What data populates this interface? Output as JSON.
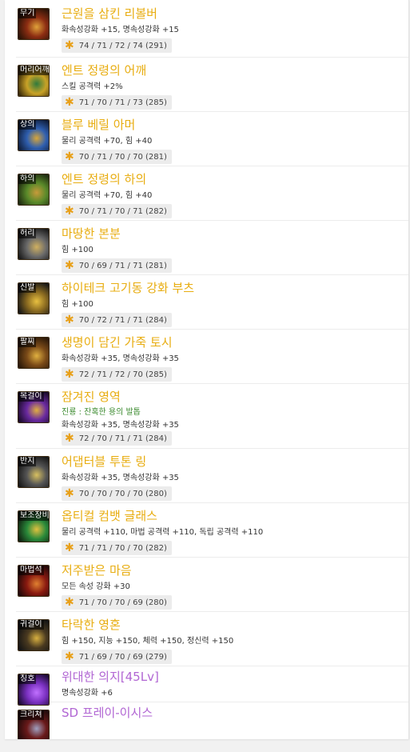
{
  "colors": {
    "legendary": "#e8ad11",
    "epic": "#b166d3",
    "mythic_option": "#3b8a2e",
    "score_star": "#e8a019"
  },
  "items": [
    {
      "slot": "무기",
      "name": "근원을 삼킨 리볼버",
      "stats": [
        "화속성강화 +15, 명속성강화 +15"
      ],
      "score": "74 / 71 / 72 / 74 (291)",
      "rarity": "legendary",
      "icon": "revolver-icon"
    },
    {
      "slot": "머리어깨",
      "name": "엔트 정령의 어깨",
      "stats": [
        "스킬 공격력 +2%"
      ],
      "score": "71 / 70 / 71 / 73 (285)",
      "rarity": "legendary",
      "icon": "shoulder-armor-icon"
    },
    {
      "slot": "상의",
      "name": "블루 베릴 아머",
      "stats": [
        "물리 공격력 +70, 힘 +40"
      ],
      "score": "70 / 71 / 70 / 70 (281)",
      "rarity": "legendary",
      "icon": "armor-icon"
    },
    {
      "slot": "하의",
      "name": "엔트 정령의 하의",
      "stats": [
        "물리 공격력 +70, 힘 +40"
      ],
      "score": "70 / 71 / 70 / 71 (282)",
      "rarity": "legendary",
      "icon": "pants-icon"
    },
    {
      "slot": "허리",
      "name": "마땅한 본분",
      "stats": [
        "힘 +100"
      ],
      "score": "70 / 69 / 71 / 71 (281)",
      "rarity": "legendary",
      "icon": "belt-icon"
    },
    {
      "slot": "신발",
      "name": "하이테크 고기동 강화 부츠",
      "stats": [
        "힘 +100"
      ],
      "score": "70 / 72 / 71 / 71 (284)",
      "rarity": "legendary",
      "icon": "boots-icon"
    },
    {
      "slot": "팔찌",
      "name": "생명이 담긴 가죽 토시",
      "stats": [
        "화속성강화 +35, 명속성강화 +35"
      ],
      "score": "72 / 71 / 72 / 70 (285)",
      "rarity": "legendary",
      "icon": "bracelet-icon"
    },
    {
      "slot": "목걸이",
      "name": "잠겨진 영역",
      "mythic_option": "진룡 : 잔혹한 용의 발톱",
      "stats": [
        "화속성강화 +35, 명속성강화 +35"
      ],
      "score": "72 / 70 / 71 / 71 (284)",
      "rarity": "legendary",
      "icon": "necklace-icon"
    },
    {
      "slot": "반지",
      "name": "어댑터블 투톤 링",
      "stats": [
        "화속성강화 +35, 명속성강화 +35"
      ],
      "score": "70 / 70 / 70 / 70 (280)",
      "rarity": "legendary",
      "icon": "ring-icon"
    },
    {
      "slot": "보조장비",
      "name": "옵티컬 컴뱃 글래스",
      "stats": [
        "물리 공격력 +110, 마법 공격력 +110, 독립 공격력 +110"
      ],
      "score": "71 / 71 / 70 / 70 (282)",
      "rarity": "legendary",
      "icon": "glasses-icon"
    },
    {
      "slot": "마법석",
      "name": "저주받은 마음",
      "stats": [
        "모든 속성 강화 +30"
      ],
      "score": "71 / 70 / 70 / 69 (280)",
      "rarity": "legendary",
      "icon": "magic-stone-icon"
    },
    {
      "slot": "귀걸이",
      "name": "타락한 영혼",
      "stats": [
        "힘 +150, 지능 +150, 체력 +150, 정신력 +150"
      ],
      "score": "71 / 69 / 70 / 69 (279)",
      "rarity": "legendary",
      "icon": "earring-icon"
    },
    {
      "slot": "칭호",
      "name": "위대한 의지[45Lv]",
      "stats": [
        "명속성강화 +6"
      ],
      "score": "",
      "rarity": "epic",
      "icon": "title-icon"
    },
    {
      "slot": "크리쳐",
      "name": "SD 프레이-이시스",
      "stats": [],
      "score": "",
      "rarity": "epic",
      "icon": "creature-icon"
    }
  ]
}
